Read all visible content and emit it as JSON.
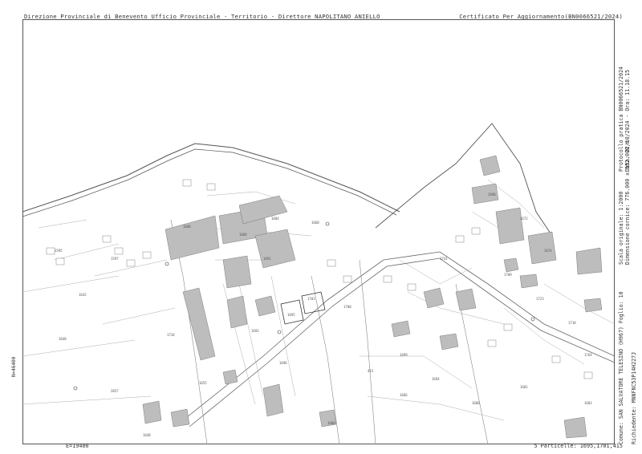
{
  "header": {
    "left_text": "Direzione Provinciale di Benevento  Ufficio Provinciale - Territorio - Direttore NAPOLITANO ANIELLO",
    "right_text": "Certificato Per Aggiornamento(BN0066521/2024)"
  },
  "side_info": {
    "date_line": "Data: 22/10/2024 - Ora: 11.18.15",
    "protocol_line": "Protocollo pratica BN0066521/2024",
    "scale_line": "Scala originale: 1:2000",
    "dims_line": "Dimensione cornice: 776.000 x 552.000 m",
    "comune_line": "Comune: SAN SALVATORE TELESINO (H967) Foglio: 10",
    "richiedente_line": "Richiedente: MNNFNC53P14H227J"
  },
  "coords": {
    "north": "N=46400",
    "east": "E=19400"
  },
  "footer": {
    "right_text": "5 Particelle: 1695,1701,415"
  },
  "parcel_labels": [
    "1595",
    "1596",
    "1597",
    "1598",
    "2006",
    "2057",
    "1642",
    "1734",
    "1640",
    "1688",
    "1641",
    "1632",
    "1655",
    "1765",
    "1728",
    "1689",
    "1729",
    "1730",
    "1731",
    "1657",
    "1658",
    "1661",
    "1659",
    "1660",
    "1745",
    "1684",
    "1691",
    "1692",
    "1687",
    "1693",
    "1696",
    "1695",
    "1701",
    "1700",
    "1746",
    "415",
    "1699",
    "1694",
    "1671",
    "1690",
    "1672",
    "1673",
    "1674",
    "1675",
    "1676",
    "1726",
    "1741",
    "1685",
    "1733",
    "1725",
    "1764",
    "1686",
    "1709",
    "1723",
    "1677",
    "1718",
    "1708",
    "1678",
    "1710",
    "1730",
    "1702",
    "1715",
    "1757",
    "1756",
    "1766",
    "1760",
    "1648",
    "1680",
    "1686",
    "1681",
    "1682",
    "1683",
    "1660",
    "1699",
    "1666"
  ]
}
